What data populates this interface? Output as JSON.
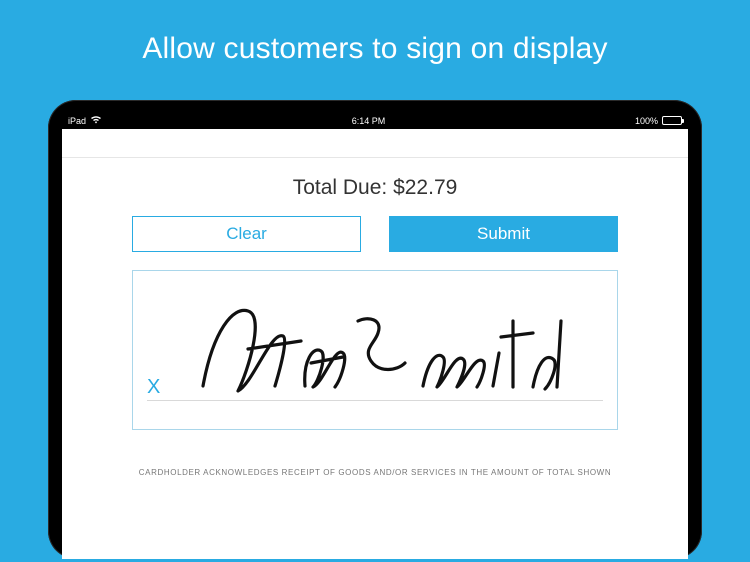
{
  "hero": {
    "title": "Allow customers to sign on display"
  },
  "status": {
    "device": "iPad",
    "time": "6:14 PM",
    "battery": "100%"
  },
  "app": {
    "total_label": "Total Due: $22.79",
    "clear_label": "Clear",
    "submit_label": "Submit",
    "legal": "CARDHOLDER ACKNOWLEDGES RECEIPT OF GOODS AND/OR SERVICES IN THE AMOUNT OF TOTAL SHOWN",
    "sig_mark": "X"
  }
}
